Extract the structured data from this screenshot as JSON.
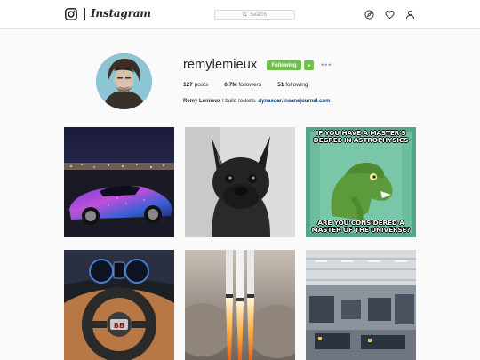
{
  "header": {
    "logo_text": "Instagram",
    "search_placeholder": "Search",
    "icons": [
      "instagram-camera-icon",
      "explore-compass-icon",
      "activity-heart-icon",
      "profile-user-icon"
    ]
  },
  "profile": {
    "username": "remylemieux",
    "follow_button_label": "Following",
    "posts_count": "127",
    "posts_label": "posts",
    "followers_count": "6.7M",
    "followers_label": "followers",
    "following_count": "51",
    "following_label": "following",
    "full_name": "Remy Lemieux",
    "bio_text": "I build rockets.",
    "website": "dynasoar.insanejournal.com"
  },
  "posts": [
    {
      "subject": "purple galaxy supercar at night"
    },
    {
      "subject": "black french bulldog"
    },
    {
      "subject": "philosoraptor meme",
      "top_text": "IF YOU HAVE A MASTER'S DEGREE IN ASTROPHYSICS",
      "bottom_text": "ARE YOU CONSIDERED A MASTER OF THE UNIVERSE?"
    },
    {
      "subject": "car steering wheel and dashboard"
    },
    {
      "subject": "rocket launch"
    },
    {
      "subject": "factory floor"
    }
  ],
  "colors": {
    "following_green": "#70c050",
    "link_blue": "#003569",
    "border": "#e6e6e6",
    "background": "#fafafa"
  }
}
